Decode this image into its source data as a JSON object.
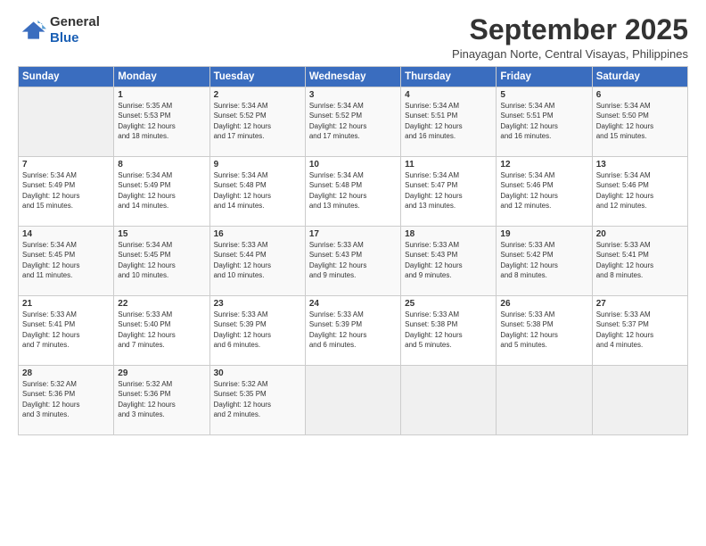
{
  "logo": {
    "line1": "General",
    "line2": "Blue"
  },
  "title": "September 2025",
  "subtitle": "Pinayagan Norte, Central Visayas, Philippines",
  "header": {
    "days": [
      "Sunday",
      "Monday",
      "Tuesday",
      "Wednesday",
      "Thursday",
      "Friday",
      "Saturday"
    ]
  },
  "weeks": [
    [
      {
        "day": "",
        "info": ""
      },
      {
        "day": "1",
        "info": "Sunrise: 5:35 AM\nSunset: 5:53 PM\nDaylight: 12 hours\nand 18 minutes."
      },
      {
        "day": "2",
        "info": "Sunrise: 5:34 AM\nSunset: 5:52 PM\nDaylight: 12 hours\nand 17 minutes."
      },
      {
        "day": "3",
        "info": "Sunrise: 5:34 AM\nSunset: 5:52 PM\nDaylight: 12 hours\nand 17 minutes."
      },
      {
        "day": "4",
        "info": "Sunrise: 5:34 AM\nSunset: 5:51 PM\nDaylight: 12 hours\nand 16 minutes."
      },
      {
        "day": "5",
        "info": "Sunrise: 5:34 AM\nSunset: 5:51 PM\nDaylight: 12 hours\nand 16 minutes."
      },
      {
        "day": "6",
        "info": "Sunrise: 5:34 AM\nSunset: 5:50 PM\nDaylight: 12 hours\nand 15 minutes."
      }
    ],
    [
      {
        "day": "7",
        "info": "Sunrise: 5:34 AM\nSunset: 5:49 PM\nDaylight: 12 hours\nand 15 minutes."
      },
      {
        "day": "8",
        "info": "Sunrise: 5:34 AM\nSunset: 5:49 PM\nDaylight: 12 hours\nand 14 minutes."
      },
      {
        "day": "9",
        "info": "Sunrise: 5:34 AM\nSunset: 5:48 PM\nDaylight: 12 hours\nand 14 minutes."
      },
      {
        "day": "10",
        "info": "Sunrise: 5:34 AM\nSunset: 5:48 PM\nDaylight: 12 hours\nand 13 minutes."
      },
      {
        "day": "11",
        "info": "Sunrise: 5:34 AM\nSunset: 5:47 PM\nDaylight: 12 hours\nand 13 minutes."
      },
      {
        "day": "12",
        "info": "Sunrise: 5:34 AM\nSunset: 5:46 PM\nDaylight: 12 hours\nand 12 minutes."
      },
      {
        "day": "13",
        "info": "Sunrise: 5:34 AM\nSunset: 5:46 PM\nDaylight: 12 hours\nand 12 minutes."
      }
    ],
    [
      {
        "day": "14",
        "info": "Sunrise: 5:34 AM\nSunset: 5:45 PM\nDaylight: 12 hours\nand 11 minutes."
      },
      {
        "day": "15",
        "info": "Sunrise: 5:34 AM\nSunset: 5:45 PM\nDaylight: 12 hours\nand 10 minutes."
      },
      {
        "day": "16",
        "info": "Sunrise: 5:33 AM\nSunset: 5:44 PM\nDaylight: 12 hours\nand 10 minutes."
      },
      {
        "day": "17",
        "info": "Sunrise: 5:33 AM\nSunset: 5:43 PM\nDaylight: 12 hours\nand 9 minutes."
      },
      {
        "day": "18",
        "info": "Sunrise: 5:33 AM\nSunset: 5:43 PM\nDaylight: 12 hours\nand 9 minutes."
      },
      {
        "day": "19",
        "info": "Sunrise: 5:33 AM\nSunset: 5:42 PM\nDaylight: 12 hours\nand 8 minutes."
      },
      {
        "day": "20",
        "info": "Sunrise: 5:33 AM\nSunset: 5:41 PM\nDaylight: 12 hours\nand 8 minutes."
      }
    ],
    [
      {
        "day": "21",
        "info": "Sunrise: 5:33 AM\nSunset: 5:41 PM\nDaylight: 12 hours\nand 7 minutes."
      },
      {
        "day": "22",
        "info": "Sunrise: 5:33 AM\nSunset: 5:40 PM\nDaylight: 12 hours\nand 7 minutes."
      },
      {
        "day": "23",
        "info": "Sunrise: 5:33 AM\nSunset: 5:39 PM\nDaylight: 12 hours\nand 6 minutes."
      },
      {
        "day": "24",
        "info": "Sunrise: 5:33 AM\nSunset: 5:39 PM\nDaylight: 12 hours\nand 6 minutes."
      },
      {
        "day": "25",
        "info": "Sunrise: 5:33 AM\nSunset: 5:38 PM\nDaylight: 12 hours\nand 5 minutes."
      },
      {
        "day": "26",
        "info": "Sunrise: 5:33 AM\nSunset: 5:38 PM\nDaylight: 12 hours\nand 5 minutes."
      },
      {
        "day": "27",
        "info": "Sunrise: 5:33 AM\nSunset: 5:37 PM\nDaylight: 12 hours\nand 4 minutes."
      }
    ],
    [
      {
        "day": "28",
        "info": "Sunrise: 5:32 AM\nSunset: 5:36 PM\nDaylight: 12 hours\nand 3 minutes."
      },
      {
        "day": "29",
        "info": "Sunrise: 5:32 AM\nSunset: 5:36 PM\nDaylight: 12 hours\nand 3 minutes."
      },
      {
        "day": "30",
        "info": "Sunrise: 5:32 AM\nSunset: 5:35 PM\nDaylight: 12 hours\nand 2 minutes."
      },
      {
        "day": "",
        "info": ""
      },
      {
        "day": "",
        "info": ""
      },
      {
        "day": "",
        "info": ""
      },
      {
        "day": "",
        "info": ""
      }
    ]
  ]
}
